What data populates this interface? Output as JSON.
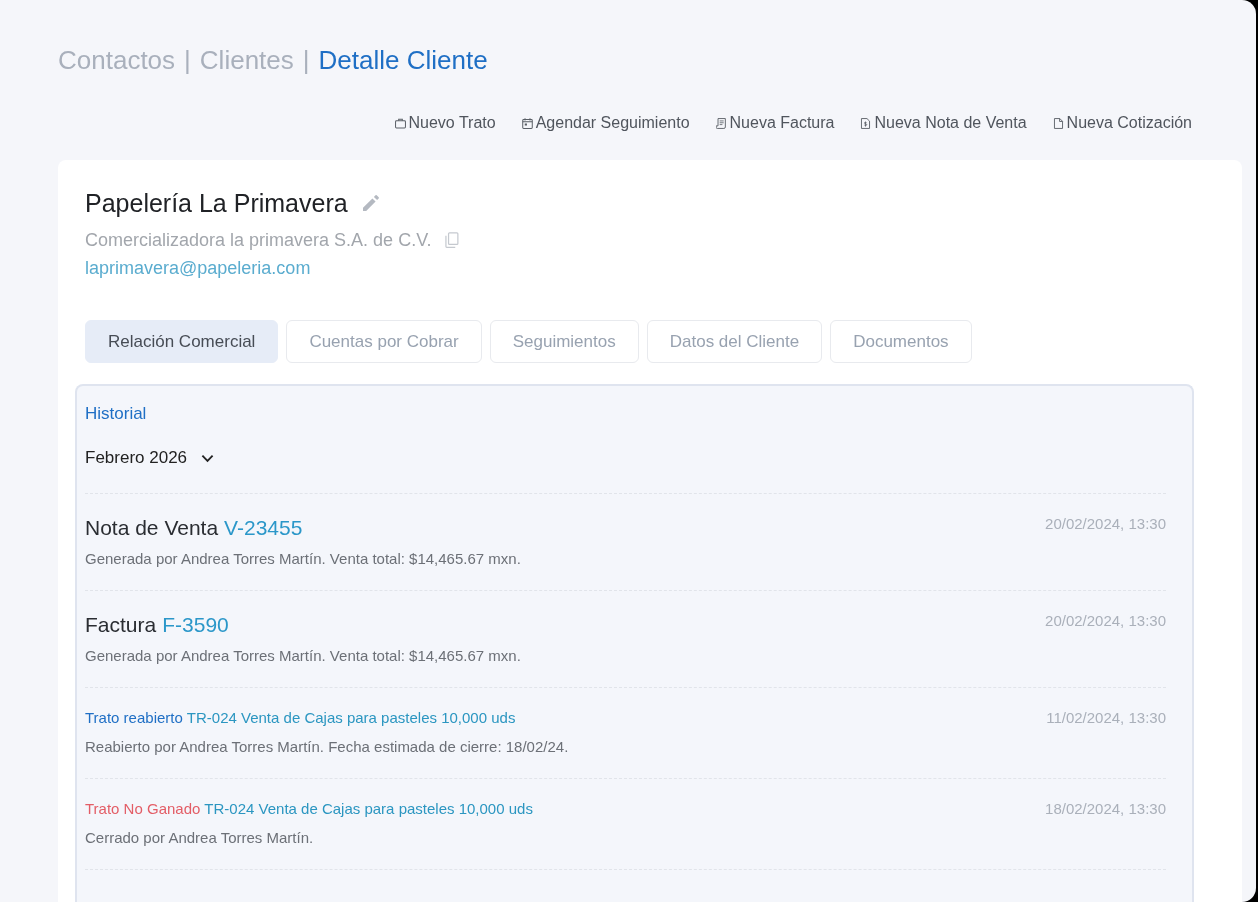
{
  "breadcrumb": [
    {
      "label": "Contactos",
      "selected": false,
      "separator": "|"
    },
    {
      "label": "Clientes",
      "selected": false,
      "separator": "|"
    },
    {
      "label": "Detalle Cliente",
      "selected": true
    }
  ],
  "actions": [
    "Nuevo Trato",
    "Agendar Seguimiento",
    "Nueva Factura",
    "Nueva Nota de Venta",
    "Nueva Cotización"
  ],
  "client": {
    "name": "Papelería La Primavera",
    "legal_name": "Comercializadora la primavera S.A. de C.V.",
    "email": "laprimavera@papeleria.com"
  },
  "tabs": [
    {
      "label": "Relación Comercial",
      "selected": true
    },
    {
      "label": "Cuentas por Cobrar",
      "selected": false
    },
    {
      "label": "Seguimientos",
      "selected": false
    },
    {
      "label": "Datos del Cliente",
      "selected": false
    },
    {
      "label": "Documentos",
      "selected": false
    }
  ],
  "history": {
    "title": "Historial",
    "month": "Febrero 2026",
    "entries": [
      {
        "kind": "document",
        "label": "Nota de Venta",
        "reference": "V-23455",
        "description": "Generada por Andrea Torres Martín. Venta total: $14,465.67 mxn.",
        "date": "20/02/2024, 13:30"
      },
      {
        "kind": "document",
        "label": "Factura",
        "reference": "F-3590",
        "description": "Generada por Andrea Torres Martín. Venta total: $14,465.67 mxn.",
        "date": "20/02/2024, 13:30"
      },
      {
        "kind": "deal",
        "status": "Trato reabierto",
        "color": "#1f6fc5",
        "reference": "TR-024 Venta de Cajas para pasteles 10,000 uds",
        "description": "Reabierto por Andrea Torres Martín. Fecha estimada de cierre: 18/02/24.",
        "date": "11/02/2024, 13:30"
      },
      {
        "kind": "deal",
        "status": "Trato No Ganado",
        "color": "#e35d66",
        "reference": "TR-024 Venta de Cajas para pasteles 10,000 uds",
        "description": "Cerrado por Andrea Torres Martín.",
        "date": "18/02/2024, 13:30"
      }
    ]
  }
}
